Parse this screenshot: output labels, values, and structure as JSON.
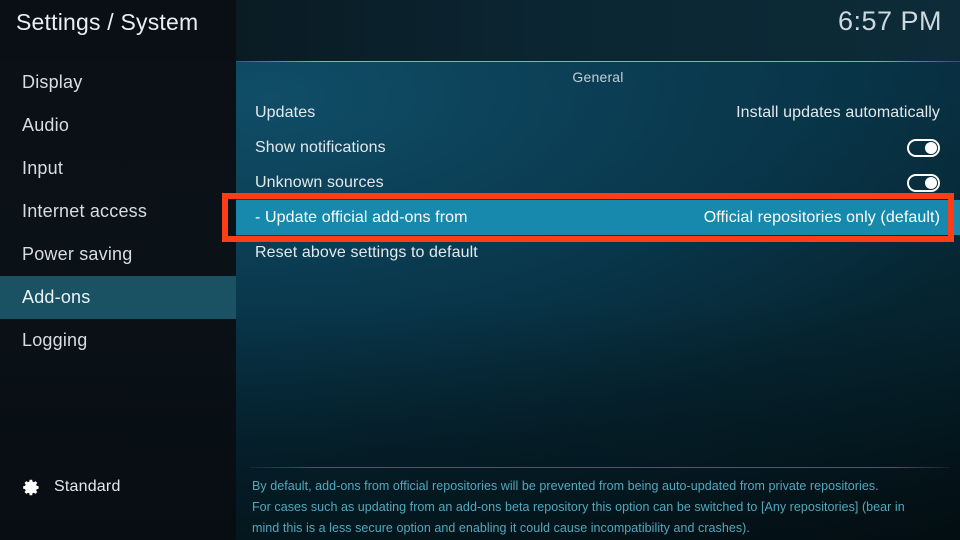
{
  "header": {
    "title": "Settings / System",
    "clock": "6:57 PM"
  },
  "sidebar": {
    "items": [
      {
        "label": "Display",
        "selected": false
      },
      {
        "label": "Audio",
        "selected": false
      },
      {
        "label": "Input",
        "selected": false
      },
      {
        "label": "Internet access",
        "selected": false
      },
      {
        "label": "Power saving",
        "selected": false
      },
      {
        "label": "Add-ons",
        "selected": true
      },
      {
        "label": "Logging",
        "selected": false
      }
    ],
    "profile": {
      "icon": "gear-icon",
      "label": "Standard"
    }
  },
  "content": {
    "group_header": "General",
    "rows": [
      {
        "label": "Updates",
        "value": "Install updates automatically",
        "type": "value",
        "selected": false
      },
      {
        "label": "Show notifications",
        "value": "on",
        "type": "toggle",
        "selected": false
      },
      {
        "label": "Unknown sources",
        "value": "on",
        "type": "toggle",
        "selected": false
      },
      {
        "label": "- Update official add-ons from",
        "value": "Official repositories only (default)",
        "type": "value",
        "selected": true
      },
      {
        "label": "Reset above settings to default",
        "value": "",
        "type": "action",
        "selected": false
      }
    ]
  },
  "description": {
    "line1": "By default, add-ons from official repositories will be prevented from being auto-updated from private repositories.",
    "line2": "For cases such as updating from an add-ons beta repository this option can be switched to [Any repositories] (bear in",
    "line3": "mind this is a less secure option and enabling it could cause incompatibility and crashes)."
  },
  "annotation": {
    "color": "#fc3d15",
    "target": "- Update official add-ons from"
  },
  "colors": {
    "selected_row": "#1789ac",
    "selected_sidebar": "#1a5263",
    "accent_rule": "#49cdeb",
    "description_text": "#53a8bd",
    "annotation": "#fc3d15"
  }
}
